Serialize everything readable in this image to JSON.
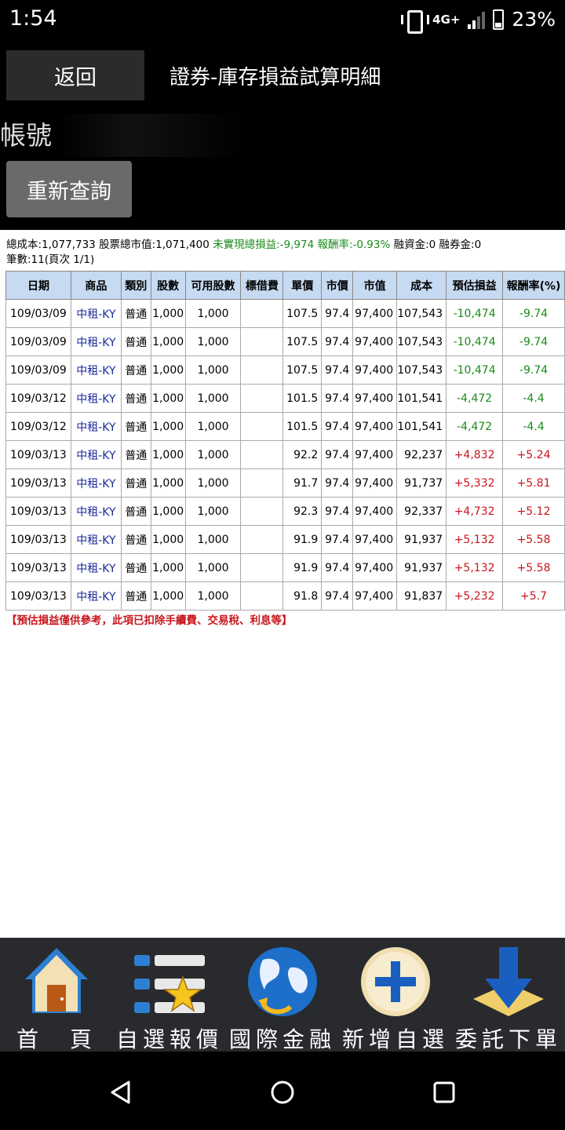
{
  "status": {
    "time": "1:54",
    "network": "4G+",
    "battery": "23%"
  },
  "header": {
    "back_label": "返回",
    "title": "證券-庫存損益試算明細",
    "account_label": "帳號",
    "requery_label": "重新查詢"
  },
  "summary": {
    "total_cost": "總成本:1,077,733",
    "market_value": "股票總市值:1,071,400",
    "unrealized": "未實現總損益:-9,974",
    "return_rate": "報酬率:-0.93%",
    "margin": "融資金:0",
    "short": "融券金:0",
    "count": "筆數:11(頁次 1/1)"
  },
  "table": {
    "headers": [
      "日期",
      "商品",
      "類別",
      "股數",
      "可用股數",
      "標借費",
      "單價",
      "市價",
      "市值",
      "成本",
      "預估損益",
      "報酬率(%)"
    ],
    "rows": [
      [
        "109/03/09",
        "中租-KY",
        "普通",
        "1,000",
        "1,000",
        "",
        "107.5",
        "97.4",
        "97,400",
        "107,543",
        "-10,474",
        "-9.74"
      ],
      [
        "109/03/09",
        "中租-KY",
        "普通",
        "1,000",
        "1,000",
        "",
        "107.5",
        "97.4",
        "97,400",
        "107,543",
        "-10,474",
        "-9.74"
      ],
      [
        "109/03/09",
        "中租-KY",
        "普通",
        "1,000",
        "1,000",
        "",
        "107.5",
        "97.4",
        "97,400",
        "107,543",
        "-10,474",
        "-9.74"
      ],
      [
        "109/03/12",
        "中租-KY",
        "普通",
        "1,000",
        "1,000",
        "",
        "101.5",
        "97.4",
        "97,400",
        "101,541",
        "-4,472",
        "-4.4"
      ],
      [
        "109/03/12",
        "中租-KY",
        "普通",
        "1,000",
        "1,000",
        "",
        "101.5",
        "97.4",
        "97,400",
        "101,541",
        "-4,472",
        "-4.4"
      ],
      [
        "109/03/13",
        "中租-KY",
        "普通",
        "1,000",
        "1,000",
        "",
        "92.2",
        "97.4",
        "97,400",
        "92,237",
        "+4,832",
        "+5.24"
      ],
      [
        "109/03/13",
        "中租-KY",
        "普通",
        "1,000",
        "1,000",
        "",
        "91.7",
        "97.4",
        "97,400",
        "91,737",
        "+5,332",
        "+5.81"
      ],
      [
        "109/03/13",
        "中租-KY",
        "普通",
        "1,000",
        "1,000",
        "",
        "92.3",
        "97.4",
        "97,400",
        "92,337",
        "+4,732",
        "+5.12"
      ],
      [
        "109/03/13",
        "中租-KY",
        "普通",
        "1,000",
        "1,000",
        "",
        "91.9",
        "97.4",
        "97,400",
        "91,937",
        "+5,132",
        "+5.58"
      ],
      [
        "109/03/13",
        "中租-KY",
        "普通",
        "1,000",
        "1,000",
        "",
        "91.9",
        "97.4",
        "97,400",
        "91,937",
        "+5,132",
        "+5.58"
      ],
      [
        "109/03/13",
        "中租-KY",
        "普通",
        "1,000",
        "1,000",
        "",
        "91.8",
        "97.4",
        "97,400",
        "91,837",
        "+5,232",
        "+5.7"
      ]
    ]
  },
  "note": "【預估損益僅供參考，此項已扣除手續費、交易稅、利息等】",
  "toolbar": {
    "items": [
      {
        "label": "首　頁",
        "icon": "home-icon"
      },
      {
        "label": "自選報價",
        "icon": "watchlist-icon"
      },
      {
        "label": "國際金融",
        "icon": "globe-icon"
      },
      {
        "label": "新增自選",
        "icon": "add-icon"
      },
      {
        "label": "委託下單",
        "icon": "order-icon"
      }
    ]
  },
  "colors": {
    "loss": "#1b8a1b",
    "gain": "#c8161d",
    "product": "#1a2a9c",
    "header_bg": "#c6daf1"
  }
}
